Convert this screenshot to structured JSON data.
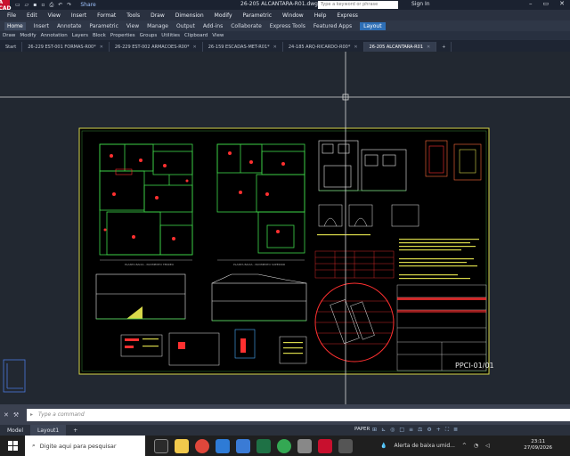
{
  "titlebar": {
    "logo": "A CAD",
    "share": "Share",
    "title": "26-205 ALCANTARA-R01.dwg",
    "search_placeholder": "Type a keyword or phrase",
    "signin": "Sign In"
  },
  "menu": [
    "File",
    "Edit",
    "View",
    "Insert",
    "Format",
    "Tools",
    "Draw",
    "Dimension",
    "Modify",
    "Parametric",
    "Window",
    "Help",
    "Express"
  ],
  "ribbon_tabs": [
    "Home",
    "Insert",
    "Annotate",
    "Parametric",
    "View",
    "Manage",
    "Output",
    "Add-ins",
    "Collaborate",
    "Express Tools",
    "Featured Apps",
    "Layout"
  ],
  "ribbon_panels": [
    "Draw",
    "Modify",
    "Annotation",
    "Layers",
    "Block",
    "Properties",
    "Groups",
    "Utilities",
    "Clipboard",
    "View"
  ],
  "file_tabs": [
    "Start",
    "26-229 EST-001 FORMAS-R00*",
    "26-229 EST-002 ARMACOES-R00*",
    "26-159 ESCADAS-MET-R01*",
    "24-185 ARQ-RICARDO-R00*",
    "26-205 ALCANTARA-R01"
  ],
  "drawing": {
    "sheet_number": "PPCI-01/01"
  },
  "command": {
    "placeholder": "Type a command"
  },
  "status": {
    "tabs": [
      "Model",
      "Layout1"
    ],
    "paper": "PAPER"
  },
  "taskbar": {
    "search_placeholder": "Digite aqui para pesquisar",
    "notification": "Alerta de baixa umid...",
    "time": "23:11",
    "date": "27/09/2026"
  }
}
